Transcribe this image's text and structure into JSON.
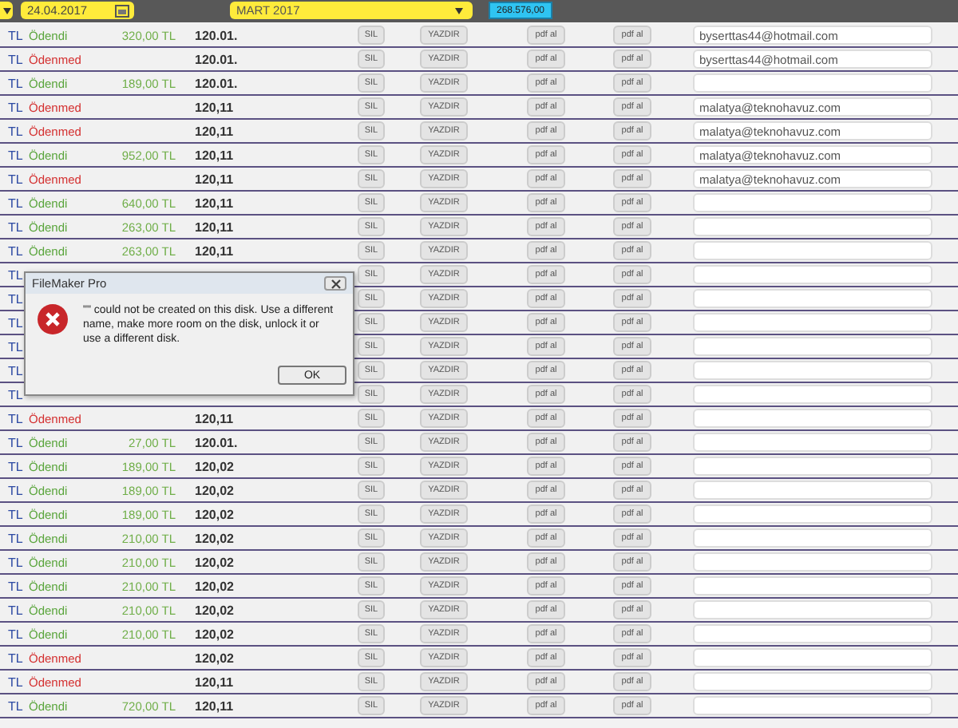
{
  "header": {
    "date_field": {
      "value": "24.04.2017"
    },
    "month_dropdown": {
      "value": "MART 2017"
    },
    "total_field": {
      "value": "268.576,00"
    }
  },
  "rows": [
    {
      "currency": "TL",
      "status": "Ödendi",
      "paid": true,
      "amount": "320,00 TL",
      "code": "120.01.",
      "delete": "SIL",
      "print": "YAZDIR",
      "pdf1": "pdf al",
      "pdf2": "pdf al",
      "email": "byserttas44@hotmail.com"
    },
    {
      "currency": "TL",
      "status": "Ödenmed",
      "paid": false,
      "code": "120.01.",
      "delete": "SIL",
      "print": "YAZDIR",
      "pdf1": "pdf al",
      "pdf2": "pdf al",
      "email": "byserttas44@hotmail.com"
    },
    {
      "currency": "TL",
      "status": "Ödendi",
      "paid": true,
      "amount": "189,00 TL",
      "code": "120.01.",
      "delete": "SIL",
      "print": "YAZDIR",
      "pdf1": "pdf al",
      "pdf2": "pdf al"
    },
    {
      "currency": "TL",
      "status": "Ödenmed",
      "paid": false,
      "code": "120,11",
      "delete": "SIL",
      "print": "YAZDIR",
      "pdf1": "pdf al",
      "pdf2": "pdf al",
      "email": "malatya@teknohavuz.com"
    },
    {
      "currency": "TL",
      "status": "Ödenmed",
      "paid": false,
      "code": "120,11",
      "delete": "SIL",
      "print": "YAZDIR",
      "pdf1": "pdf al",
      "pdf2": "pdf al",
      "email": "malatya@teknohavuz.com"
    },
    {
      "currency": "TL",
      "status": "Ödendi",
      "paid": true,
      "amount": "952,00 TL",
      "code": "120,11",
      "delete": "SIL",
      "print": "YAZDIR",
      "pdf1": "pdf al",
      "pdf2": "pdf al",
      "email": "malatya@teknohavuz.com"
    },
    {
      "currency": "TL",
      "status": "Ödenmed",
      "paid": false,
      "code": "120,11",
      "delete": "SIL",
      "print": "YAZDIR",
      "pdf1": "pdf al",
      "pdf2": "pdf al",
      "email": "malatya@teknohavuz.com"
    },
    {
      "currency": "TL",
      "status": "Ödendi",
      "paid": true,
      "amount": "640,00 TL",
      "code": "120,11",
      "delete": "SIL",
      "print": "YAZDIR",
      "pdf1": "pdf al",
      "pdf2": "pdf al"
    },
    {
      "currency": "TL",
      "status": "Ödendi",
      "paid": true,
      "amount": "263,00 TL",
      "code": "120,11",
      "delete": "SIL",
      "print": "YAZDIR",
      "pdf1": "pdf al",
      "pdf2": "pdf al"
    },
    {
      "currency": "TL",
      "status": "Ödendi",
      "paid": true,
      "amount": "263,00 TL",
      "code": "120,11",
      "delete": "SIL",
      "print": "YAZDIR",
      "pdf1": "pdf al",
      "pdf2": "pdf al"
    },
    {
      "currency": "TL",
      "delete": "SIL",
      "print": "YAZDIR",
      "pdf1": "pdf al",
      "pdf2": "pdf al"
    },
    {
      "currency": "TL",
      "delete": "SIL",
      "print": "YAZDIR",
      "pdf1": "pdf al",
      "pdf2": "pdf al"
    },
    {
      "currency": "TL",
      "delete": "SIL",
      "print": "YAZDIR",
      "pdf1": "pdf al",
      "pdf2": "pdf al"
    },
    {
      "currency": "TL",
      "delete": "SIL",
      "print": "YAZDIR",
      "pdf1": "pdf al",
      "pdf2": "pdf al"
    },
    {
      "currency": "TL",
      "delete": "SIL",
      "print": "YAZDIR",
      "pdf1": "pdf al",
      "pdf2": "pdf al"
    },
    {
      "currency": "TL",
      "delete": "SIL",
      "print": "YAZDIR",
      "pdf1": "pdf al",
      "pdf2": "pdf al"
    },
    {
      "currency": "TL",
      "status": "Ödenmed",
      "paid": false,
      "code": "120,11",
      "delete": "SIL",
      "print": "YAZDIR",
      "pdf1": "pdf al",
      "pdf2": "pdf al"
    },
    {
      "currency": "TL",
      "status": "Ödendi",
      "paid": true,
      "amount": "27,00 TL",
      "code": "120.01.",
      "delete": "SIL",
      "print": "YAZDIR",
      "pdf1": "pdf al",
      "pdf2": "pdf al"
    },
    {
      "currency": "TL",
      "status": "Ödendi",
      "paid": true,
      "amount": "189,00 TL",
      "code": "120,02",
      "delete": "SIL",
      "print": "YAZDIR",
      "pdf1": "pdf al",
      "pdf2": "pdf al"
    },
    {
      "currency": "TL",
      "status": "Ödendi",
      "paid": true,
      "amount": "189,00 TL",
      "code": "120,02",
      "delete": "SIL",
      "print": "YAZDIR",
      "pdf1": "pdf al",
      "pdf2": "pdf al"
    },
    {
      "currency": "TL",
      "status": "Ödendi",
      "paid": true,
      "amount": "189,00 TL",
      "code": "120,02",
      "delete": "SIL",
      "print": "YAZDIR",
      "pdf1": "pdf al",
      "pdf2": "pdf al"
    },
    {
      "currency": "TL",
      "status": "Ödendi",
      "paid": true,
      "amount": "210,00 TL",
      "code": "120,02",
      "delete": "SIL",
      "print": "YAZDIR",
      "pdf1": "pdf al",
      "pdf2": "pdf al"
    },
    {
      "currency": "TL",
      "status": "Ödendi",
      "paid": true,
      "amount": "210,00 TL",
      "code": "120,02",
      "delete": "SIL",
      "print": "YAZDIR",
      "pdf1": "pdf al",
      "pdf2": "pdf al"
    },
    {
      "currency": "TL",
      "status": "Ödendi",
      "paid": true,
      "amount": "210,00 TL",
      "code": "120,02",
      "delete": "SIL",
      "print": "YAZDIR",
      "pdf1": "pdf al",
      "pdf2": "pdf al"
    },
    {
      "currency": "TL",
      "status": "Ödendi",
      "paid": true,
      "amount": "210,00 TL",
      "code": "120,02",
      "delete": "SIL",
      "print": "YAZDIR",
      "pdf1": "pdf al",
      "pdf2": "pdf al"
    },
    {
      "currency": "TL",
      "status": "Ödendi",
      "paid": true,
      "amount": "210,00 TL",
      "code": "120,02",
      "delete": "SIL",
      "print": "YAZDIR",
      "pdf1": "pdf al",
      "pdf2": "pdf al"
    },
    {
      "currency": "TL",
      "status": "Ödenmed",
      "paid": false,
      "code": "120,02",
      "delete": "SIL",
      "print": "YAZDIR",
      "pdf1": "pdf al",
      "pdf2": "pdf al"
    },
    {
      "currency": "TL",
      "status": "Ödenmed",
      "paid": false,
      "code": "120,11",
      "delete": "SIL",
      "print": "YAZDIR",
      "pdf1": "pdf al",
      "pdf2": "pdf al"
    },
    {
      "currency": "TL",
      "status": "Ödendi",
      "paid": true,
      "amount": "720,00 TL",
      "code": "120,11",
      "delete": "SIL",
      "print": "YAZDIR",
      "pdf1": "pdf al",
      "pdf2": "pdf al"
    }
  ],
  "dialog": {
    "title": "FileMaker Pro",
    "message": "\"\" could not be created on this disk.  Use a different name, make more room on the disk, unlock it or use a different disk.",
    "ok_button": "OK"
  }
}
